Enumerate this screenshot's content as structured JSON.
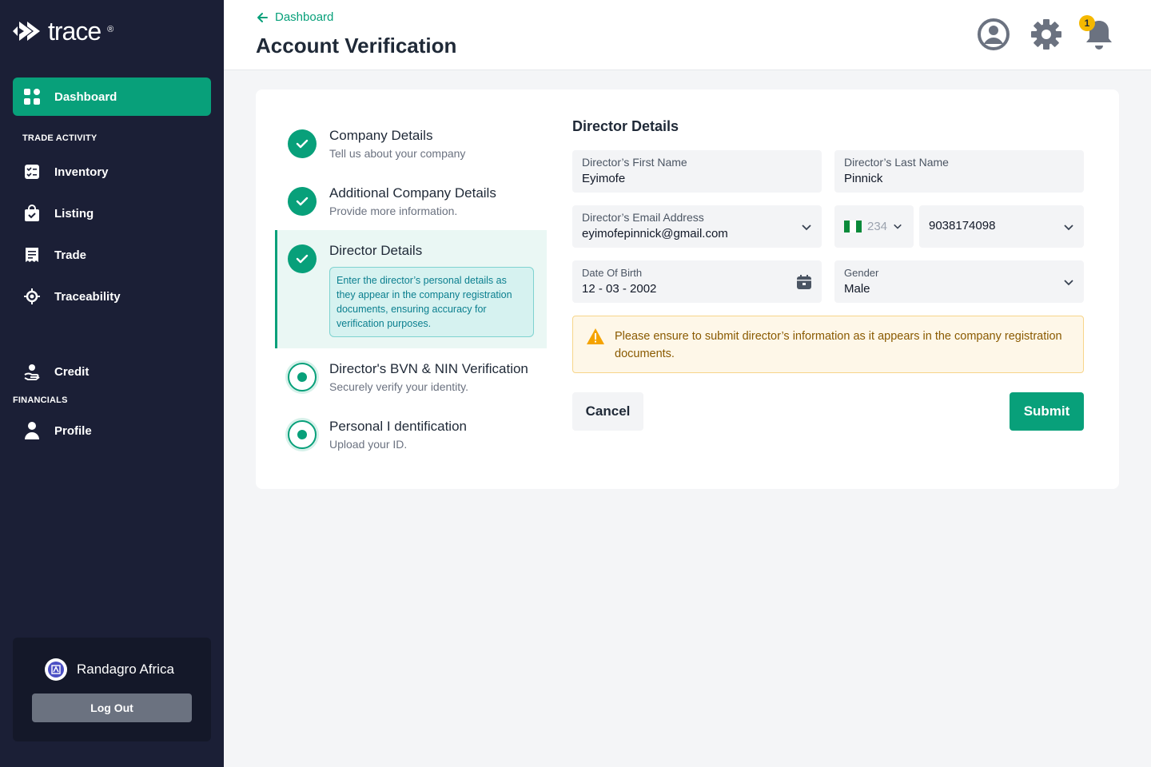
{
  "brand": {
    "name": "trace",
    "reg": "®"
  },
  "sidebar": {
    "active": {
      "label": "Dashboard"
    },
    "section_trade": "TRADE ACTIVITY",
    "items": [
      {
        "label": "Inventory"
      },
      {
        "label": "Listing"
      },
      {
        "label": "Trade"
      },
      {
        "label": "Traceability"
      },
      {
        "label": "Credit"
      }
    ],
    "section_financials": "FINANCIALS",
    "profile": {
      "label": "Profile"
    },
    "org": {
      "name": "Randagro Africa",
      "logout": "Log Out"
    }
  },
  "header": {
    "back": "Dashboard",
    "title": "Account Verification",
    "notification_count": "1"
  },
  "steps": [
    {
      "title": "Company Details",
      "subtitle": "Tell us about your company",
      "status": "done"
    },
    {
      "title": "Additional Company Details",
      "subtitle": "Provide more information.",
      "status": "done"
    },
    {
      "title": "Director Details",
      "note": "Enter the director’s personal details as they appear in the company registration documents, ensuring accuracy for verification purposes.",
      "status": "active"
    },
    {
      "title": "Director's BVN & NIN Verification",
      "subtitle": "Securely verify your identity.",
      "status": "pending"
    },
    {
      "title": "Personal I dentification",
      "subtitle": "Upload your ID.",
      "status": "pending"
    }
  ],
  "form": {
    "title": "Director Details",
    "first_name": {
      "label": "Director’s First Name",
      "value": "Eyimofe"
    },
    "last_name": {
      "label": "Director’s Last Name",
      "value": "Pinnick"
    },
    "email": {
      "label": "Director’s Email Address",
      "value": "eyimofepinnick@gmail.com"
    },
    "phone": {
      "code": "234",
      "value": "9038174098"
    },
    "dob": {
      "label": "Date Of Birth",
      "value": "12 - 03 - 2002"
    },
    "gender": {
      "label": "Gender",
      "value": "Male"
    },
    "alert": "Please ensure to submit director’s information as it appears in the company registration documents.",
    "cancel": "Cancel",
    "submit": "Submit"
  },
  "colors": {
    "accent": "#08a07a",
    "sidebar": "#1b1f36",
    "warning": "#f5a300"
  }
}
